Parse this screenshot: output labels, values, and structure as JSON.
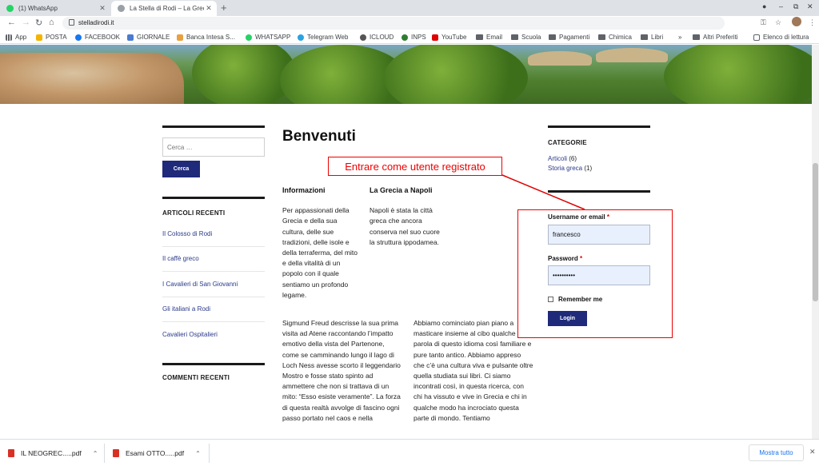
{
  "browser": {
    "tabs": [
      {
        "label": "(1) WhatsApp",
        "favicon_color": "#25d366"
      },
      {
        "label": "La Stella di Rodi – La Greci",
        "favicon_color": "#9aa0a6"
      }
    ],
    "new_tab": "+",
    "url": "stelladirodi.it",
    "window_controls": [
      "●",
      "–",
      "⧉",
      "✕"
    ]
  },
  "bookmarks": [
    {
      "label": "App",
      "type": "apps"
    },
    {
      "label": "POSTA",
      "color": "#f4b400"
    },
    {
      "label": "FACEBOOK",
      "color": "#1877f2"
    },
    {
      "label": "GIORNALE",
      "color": "#4a7bd0"
    },
    {
      "label": "Banca Intesa S...",
      "color": "#e8a040"
    },
    {
      "label": "WHATSAPP",
      "color": "#25d366"
    },
    {
      "label": "Telegram Web",
      "color": "#2aa3e0"
    },
    {
      "label": "ICLOUD",
      "color": "#555555"
    },
    {
      "label": "INPS",
      "color": "#2e7d32"
    },
    {
      "label": "YouTube",
      "color": "#e00000"
    },
    {
      "label": "Email",
      "type": "folder"
    },
    {
      "label": "Scuola",
      "type": "folder"
    },
    {
      "label": "Pagamenti",
      "type": "folder"
    },
    {
      "label": "Chimica",
      "type": "folder"
    },
    {
      "label": "Libri",
      "type": "folder"
    }
  ],
  "bookmarks_overflow": "»",
  "bookmarks_right": {
    "other": "Altri Preferiti",
    "reading_list": "Elenco di lettura"
  },
  "sidebar_left": {
    "search_placeholder": "Cerca …",
    "search_button": "Cerca",
    "recent_title": "ARTICOLI RECENTI",
    "recent_articles": [
      "Il Colosso di Rodi",
      "Il caffè greco",
      "I Cavalieri di San Giovanni",
      "Gli italiani a Rodi",
      "Cavalieri Ospitalieri"
    ],
    "comments_title": "COMMENTI RECENTI"
  },
  "main": {
    "title": "Benvenuti",
    "col1_heading": "Informazioni",
    "col1_text": "Per appassionati della Grecia e della sua cultura, delle sue tradizioni, delle isole e della terraferma, del mito e della vitalità di un popolo con il quale sentiamo un profondo legame.",
    "col2_heading": "La Grecia a Napoli",
    "col2_text": "Napoli è stata la città greca che ancora conserva nel suo cuore la struttura ippodamea.",
    "col3_text": "Sigmund Freud descrisse la sua prima visita ad Atene raccontando l’impatto emotivo della vista del Partenone, come se camminando lungo il lago di Loch Ness avesse scorto il leggendario Mostro e fosse stato spinto ad ammettere che non si trattava di un mito: “Esso esiste veramente”. La forza di questa realtà avvolge di fascino ogni passo portato nel caos e nella",
    "col4_text": "Abbiamo cominciato pian piano a masticare insieme al cibo qualche parola di questo idioma così familiare e pure tanto antico. Abbiamo appreso che c’è una cultura viva e pulsante oltre quella studiata sui libri. Ci siamo incontrati così, in questa ricerca, con chi ha vissuto e vive in Grecia e chi in qualche modo ha incrociato questa parte di mondo. Tentiamo"
  },
  "sidebar_right": {
    "categories_title": "CATEGORIE",
    "categories": [
      {
        "name": "Articoli",
        "count": "(6)"
      },
      {
        "name": "Storia greca",
        "count": "(1)"
      }
    ],
    "login": {
      "username_label": "Username or email",
      "username_value": "francesco",
      "password_label": "Password",
      "password_value": "••••••••••",
      "required_mark": "*",
      "remember_label": "Remember me",
      "login_button": "Login"
    }
  },
  "annotation": {
    "text": "Entrare come utente registrato",
    "color": "#e00000"
  },
  "downloads": {
    "items": [
      "IL NEOGREC.....pdf",
      "Esami OTTO.....pdf"
    ],
    "show_all": "Mostra tutto",
    "close": "✕"
  },
  "colors": {
    "button_primary": "#1f2a7a",
    "link": "#2b3a8a"
  }
}
